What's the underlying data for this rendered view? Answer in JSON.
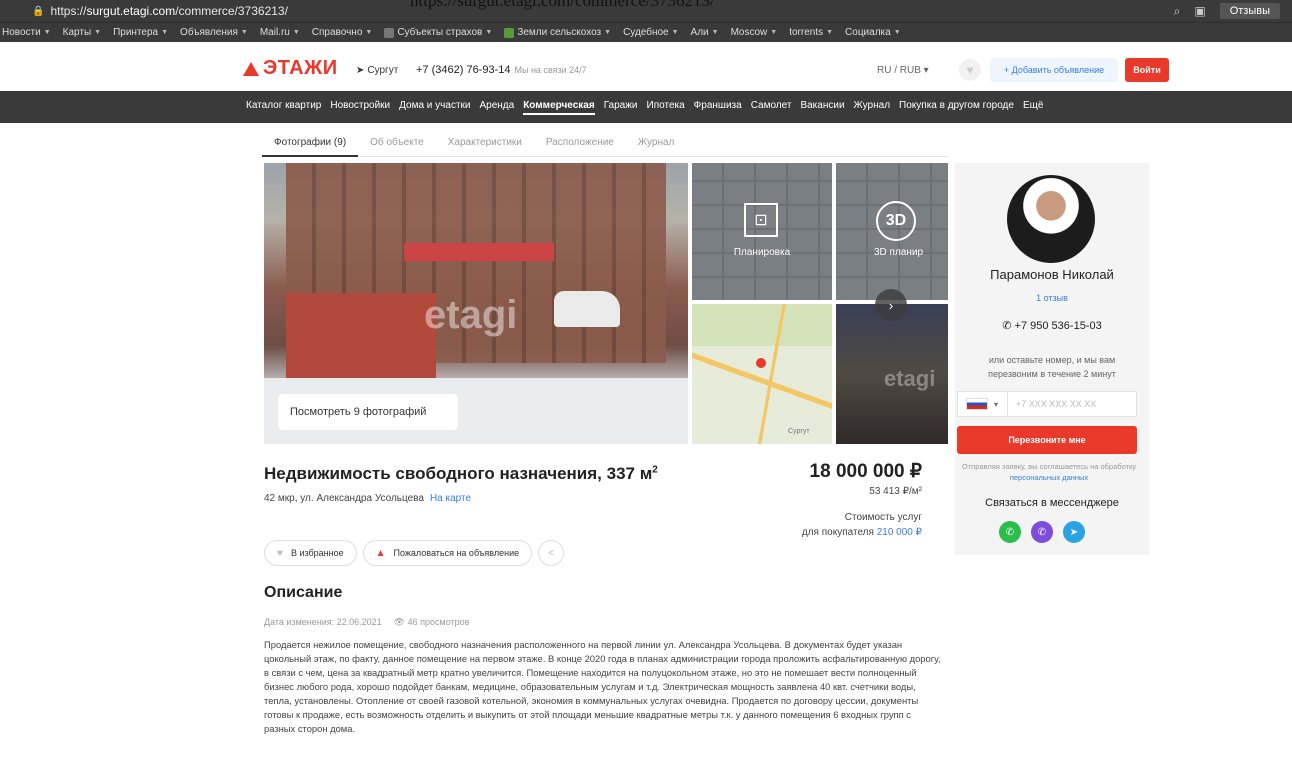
{
  "browser": {
    "url_scheme": "https://",
    "url_host": "surgut.etagi.com",
    "url_path": "/commerce/3736213/",
    "url_overlay": "https://surgut.etagi.com/commerce/3736213/",
    "reviews_label": "Отзывы"
  },
  "bookmarks": [
    "Новости",
    "Карты",
    "Принтера",
    "Объявления",
    "Mail.ru",
    "Справочно",
    "Субъекты страхов",
    "Земли сельскохоз",
    "Судебное",
    "Али",
    "Moscow",
    "torrents",
    "Социалка"
  ],
  "header": {
    "logo_text": "ЭТАЖИ",
    "city": "Сургут",
    "phone": "+7 (3462) 76-93-14",
    "phone_note": "Мы на связи 24/7",
    "lang": "RU / RUB",
    "add_label": "+ Добавить объявление",
    "login_label": "Войти"
  },
  "nav": {
    "items": [
      "Каталог квартир",
      "Новостройки",
      "Дома и участки",
      "Аренда",
      "Коммерческая",
      "Гаражи",
      "Ипотека",
      "Франшиза",
      "Самолет",
      "Вакансии",
      "Журнал",
      "Покупка в другом городе",
      "Ещё"
    ],
    "active_index": 4
  },
  "tabs": [
    "Фотографии (9)",
    "Об объекте",
    "Характеристики",
    "Расположение",
    "Журнал"
  ],
  "gallery": {
    "view_all": "Посмотреть 9 фотографий",
    "watermark": "etagi",
    "plan_label": "Планировка",
    "plan3d_badge": "3D",
    "plan3d_label": "3D планир",
    "map_label": "Сургут"
  },
  "listing": {
    "title": "Недвижимость свободного назначения, 337 м",
    "title_sup": "2",
    "address": "42 мкр, ул. Александра Усольцева",
    "map_link": "На карте",
    "price": "18 000 000 ₽",
    "price_m2": "53 413 ₽/м²",
    "svc_line1": "Стоимость услуг",
    "svc_line2": "для покупателя",
    "svc_amount": "210 000 ₽",
    "fav_label": "В избранное",
    "report_label": "Пожаловаться на объявление"
  },
  "description": {
    "heading": "Описание",
    "date": "Дата изменения: 22.06.2021",
    "views": "46 просмотров",
    "text": "Продается нежилое помещение, свободного назначения расположенного на первой линии ул. Александра Усольцева. В документах будет указан цокольный этаж, по факту, данное помещение на первом этаже. В конце 2020 года в планах администрации города проложить асфальтированную дорогу, в связи с чем, цена за квадратный метр кратно увеличится. Помещение находится на полуцокольном этаже, но это не помешает вести полноценный бизнес любого рода, хорошо подойдет банкам, медицине, образовательным услугам и т.д. Электрическая мощность заявлена 40 квт. счетчики воды, тепла, установлены. Отопление от своей газовой котельной, экономия в коммунальных услугах очевидна. Продается по договору цессии, документы готовы к продаже, есть возможность отделить и выкупить от этой площади меньшие квадратные метры т.к. у данного помещения 6 входных групп с разных сторон дома."
  },
  "agent": {
    "name": "Парамонов Николай",
    "reviews": "1 отзыв",
    "phone": "+7 950 536-15-03",
    "callback": "или оставьте номер, и мы вам перезвоним в течение 2 минут",
    "phone_placeholder": "+7 XXX XXX XX XX",
    "cta": "Перезвоните мне",
    "consent": "Отправляя заявку, вы соглашаетесь на обработку",
    "consent_link": "персональных данных",
    "messengers": "Связаться в мессенджере"
  },
  "colors": {
    "brand": "#e8392b",
    "link": "#3b7dd8",
    "nav_bg": "#3a3a3a"
  }
}
